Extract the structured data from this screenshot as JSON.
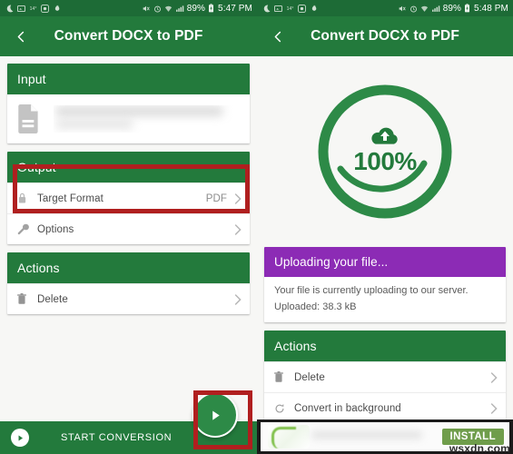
{
  "colors": {
    "green": "#237a3c",
    "green_dark": "#1d6b36",
    "purple": "#8c2bb5",
    "annotation_red": "#b01f1f",
    "install_green": "#6f9d4b",
    "page_bg": "#f7f7f5"
  },
  "left": {
    "statusbar": {
      "left_icons": [
        "moon-icon",
        "screenshot-icon",
        "temperature-icon",
        "app-badge-icon",
        "flame-icon"
      ],
      "right_icons": [
        "mute-icon",
        "alarm-icon",
        "wifi-icon",
        "signal-icon"
      ],
      "battery": "89%",
      "battery_icon": "battery-charging-icon",
      "time": "5:47 PM"
    },
    "appbar": {
      "back_icon": "back-arrow-icon",
      "title": "Convert DOCX to PDF"
    },
    "input_card": {
      "header": "Input",
      "file_icon": "document-icon",
      "file_name": ""
    },
    "output_card": {
      "header": "Output",
      "rows": [
        {
          "icon": "lock-icon",
          "label": "Target Format",
          "value": "PDF",
          "chevron": "chevron-right-icon"
        },
        {
          "icon": "wrench-icon",
          "label": "Options",
          "value": "",
          "chevron": "chevron-right-icon"
        }
      ]
    },
    "actions_card": {
      "header": "Actions",
      "rows": [
        {
          "icon": "trash-icon",
          "label": "Delete",
          "value": "",
          "chevron": "chevron-right-icon"
        }
      ]
    },
    "bottombar": {
      "icon": "play-circle-icon",
      "label": "START CONVERSION"
    },
    "fab": {
      "icon": "play-icon"
    },
    "annotations": [
      {
        "name": "target-format-highlight"
      },
      {
        "name": "start-conversion-fab-highlight"
      }
    ]
  },
  "right": {
    "statusbar": {
      "left_icons": [
        "moon-icon",
        "screenshot-icon",
        "temperature-icon",
        "app-badge-icon",
        "flame-icon"
      ],
      "right_icons": [
        "mute-icon",
        "alarm-icon",
        "wifi-icon",
        "signal-icon"
      ],
      "battery": "89%",
      "battery_icon": "battery-charging-icon",
      "time": "5:48 PM"
    },
    "appbar": {
      "back_icon": "back-arrow-icon",
      "title": "Convert DOCX to PDF"
    },
    "progress": {
      "icon": "cloud-upload-icon",
      "percent_label": "100%",
      "percent_value": 100
    },
    "status_card": {
      "header": "Uploading your file...",
      "line1": "Your file is currently uploading to our server.",
      "line2": "Uploaded: 38.3 kB"
    },
    "actions_card": {
      "header": "Actions",
      "rows": [
        {
          "icon": "trash-icon",
          "label": "Delete",
          "value": "",
          "chevron": "chevron-right-icon"
        },
        {
          "icon": "refresh-icon",
          "label": "Convert in background",
          "value": "",
          "chevron": "chevron-right-icon"
        }
      ]
    },
    "ad": {
      "install_label": "INSTALL",
      "watermark": "wsxdn.com"
    }
  }
}
